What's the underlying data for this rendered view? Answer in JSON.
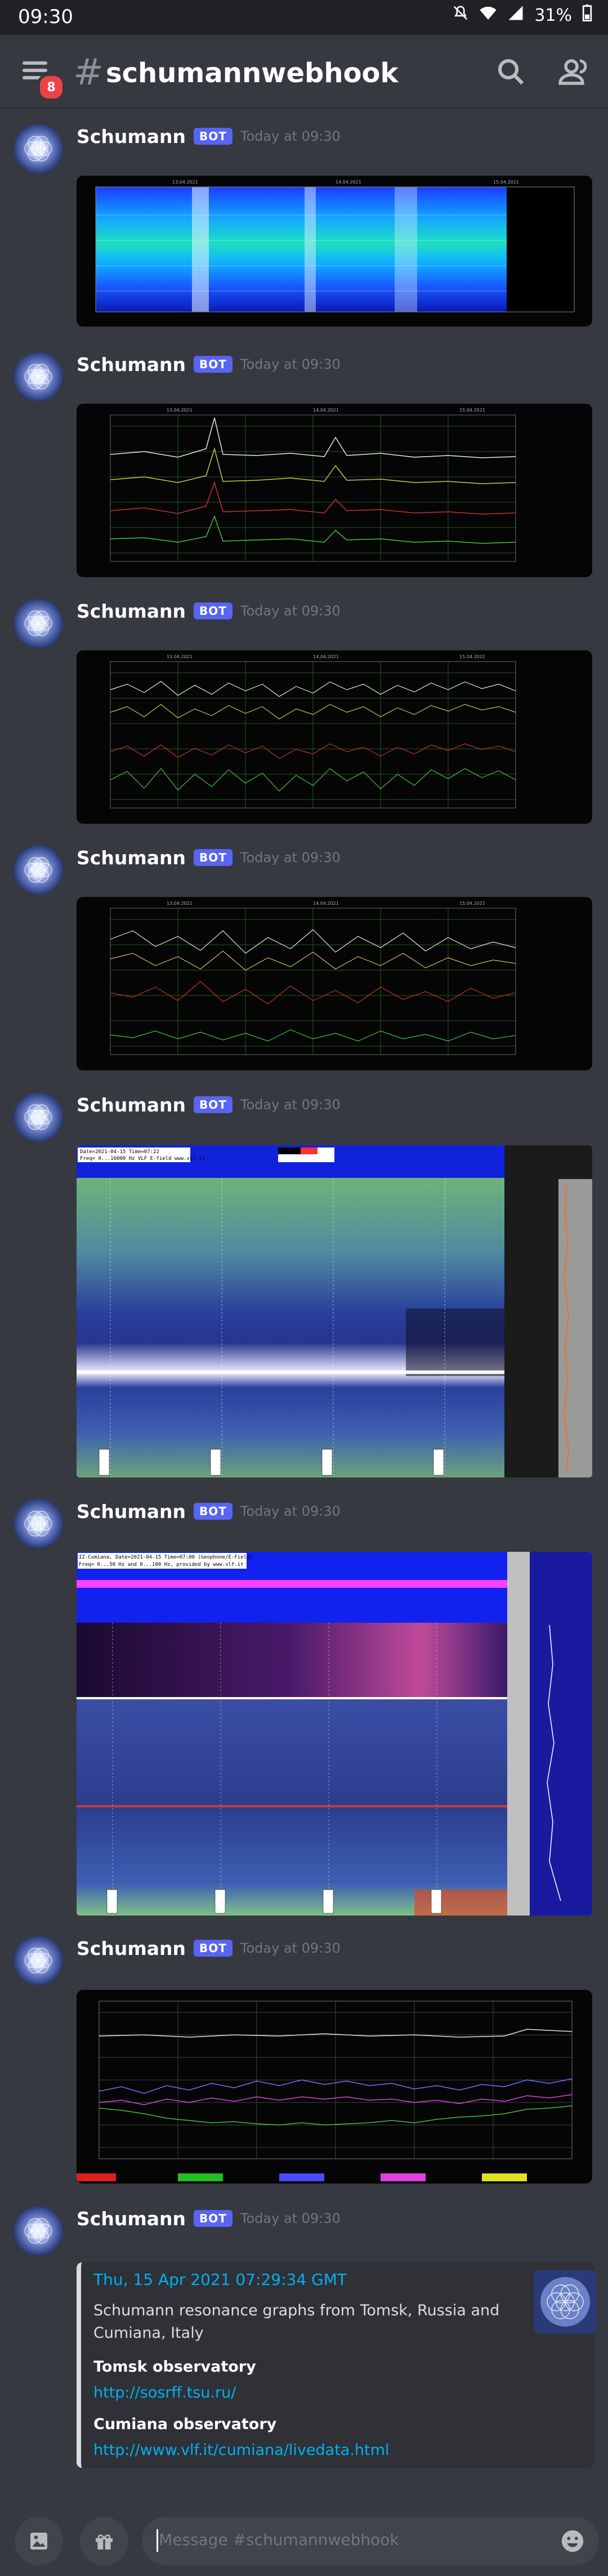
{
  "status_bar": {
    "time": "09:30",
    "battery": "31%"
  },
  "app_bar": {
    "hash": "#",
    "channel": "schumannwebhook",
    "notification_count": "8"
  },
  "messages": [
    {
      "author": "Schumann",
      "tag": "BOT",
      "time": "Today at 09:30",
      "image": "spectrogram-tomsk"
    },
    {
      "author": "Schumann",
      "tag": "BOT",
      "time": "Today at 09:30",
      "image": "amplitude-chart-tomsk"
    },
    {
      "author": "Schumann",
      "tag": "BOT",
      "time": "Today at 09:30",
      "image": "frequency-chart-tomsk"
    },
    {
      "author": "Schumann",
      "tag": "BOT",
      "time": "Today at 09:30",
      "image": "q-factor-chart-tomsk"
    },
    {
      "author": "Schumann",
      "tag": "BOT",
      "time": "Today at 09:30",
      "image": "vlf-spectrogram-cumiana"
    },
    {
      "author": "Schumann",
      "tag": "BOT",
      "time": "Today at 09:30",
      "image": "elf-spectrogram-cumiana"
    },
    {
      "author": "Schumann",
      "tag": "BOT",
      "time": "Today at 09:30",
      "image": "line-chart-cumiana"
    },
    {
      "author": "Schumann",
      "tag": "BOT",
      "time": "Today at 09:30",
      "image": "embed"
    }
  ],
  "chart_labels": {
    "date1": "13.04.2021",
    "date2": "14.04.2021",
    "date3": "15.04.2021",
    "vlf_header_1": "Date=2021-04-15 Time=07:22",
    "vlf_header_2": "Freq= 0...16000 Hz   VLF E-field www.vlf.it",
    "elf_header_1": "IZ-Cumiana, Date=2021-04-15 Time=07:00 (Geophone/E-Field)",
    "elf_header_2": "Freq= 0...50 Hz and 0...100 Hz, provided by www.vlf.it"
  },
  "embed": {
    "timestamp": "Thu, 15 Apr 2021 07:29:34 GMT",
    "description": "Schumann resonance graphs from Tomsk, Russia and Cumiana, Italy",
    "field1_title": "Tomsk observatory",
    "field1_link": "http://sosrff.tsu.ru/",
    "field2_title": "Cumiana observatory",
    "field2_link": "http://www.vlf.it/cumiana/livedata.html"
  },
  "composer": {
    "placeholder": "Message #schumannwebhook"
  },
  "colors": {
    "blurple": "#5865f2",
    "link": "#00b0f4",
    "background": "#36393f"
  }
}
